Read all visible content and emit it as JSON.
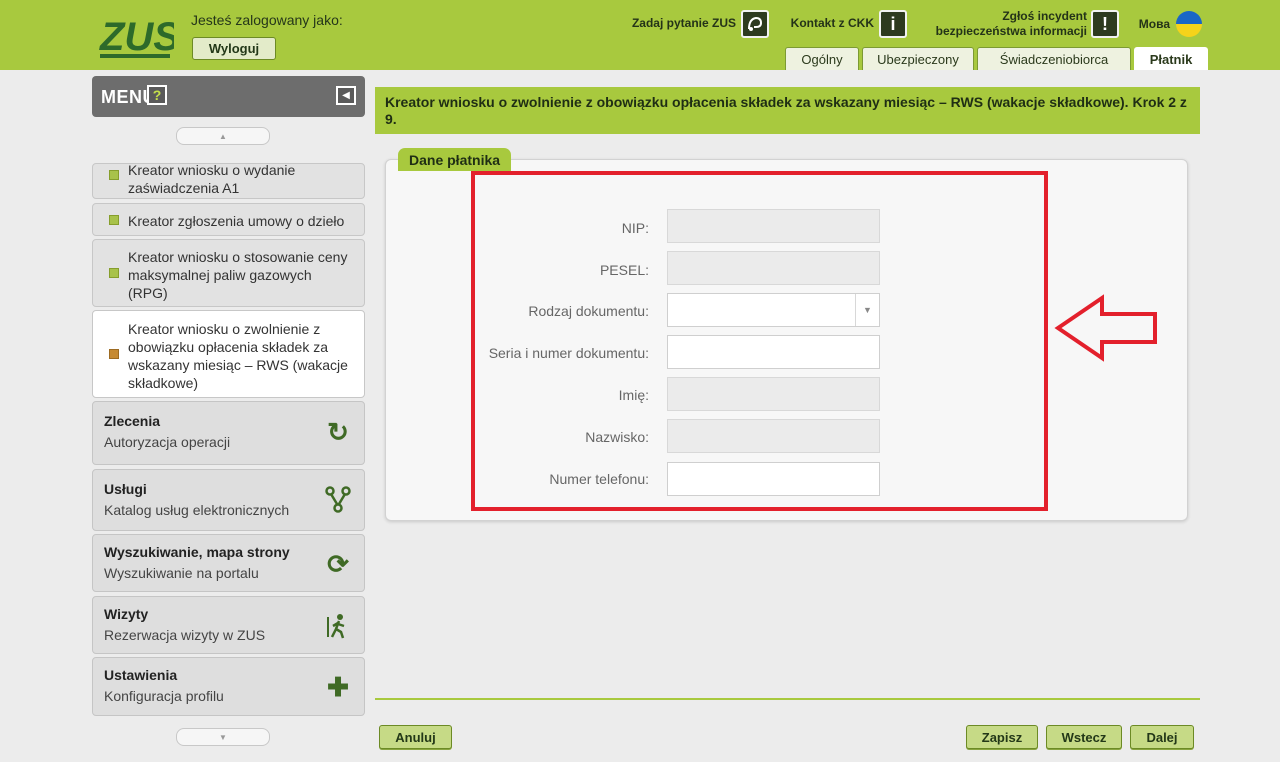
{
  "header": {
    "logo_text": "ZUS",
    "logged_label": "Jesteś zalogowany jako:",
    "logout_label": "Wyloguj",
    "ask_zus": "Zadaj pytanie ZUS",
    "contact_ckk": "Kontakt z CKK",
    "report_line1": "Zgłoś incydent",
    "report_line2": "bezpieczeństwa informacji",
    "lang_label": "Мова",
    "tabs": [
      "Ogólny",
      "Ubezpieczony",
      "Świadczeniobiorca",
      "Płatnik"
    ],
    "active_tab": "Płatnik",
    "colors": {
      "brand_green": "#a8c93e",
      "dark_green": "#3f6a25",
      "highlight_red": "#e3202c"
    }
  },
  "sidebar": {
    "menu_title": "MENU",
    "help_icon": "?",
    "items": [
      {
        "label": "Kreator wniosku o wydanie zaświadczenia A1"
      },
      {
        "label": "Kreator zgłoszenia umowy o dzieło"
      },
      {
        "label": "Kreator wniosku o stosowanie ceny maksymalnej paliw gazowych (RPG)"
      },
      {
        "label": "Kreator wniosku o zwolnienie z obowiązku opłacenia składek za wskazany miesiąc – RWS (wakacje składkowe)"
      }
    ],
    "categories": [
      {
        "title": "Zlecenia",
        "subtitle": "Autoryzacja operacji",
        "icon": "refresh-icon"
      },
      {
        "title": "Usługi",
        "subtitle": "Katalog usług elektronicznych",
        "icon": "services-icon"
      },
      {
        "title": "Wyszukiwanie, mapa strony",
        "subtitle": "Wyszukiwanie na portalu",
        "icon": "sync-icon"
      },
      {
        "title": "Wizyty",
        "subtitle": "Rezerwacja wizyty w ZUS",
        "icon": "walking-person-icon"
      },
      {
        "title": "Ustawienia",
        "subtitle": "Konfiguracja profilu",
        "icon": "puzzle-icon"
      }
    ]
  },
  "main": {
    "title": "Kreator wniosku o zwolnienie z obowiązku opłacenia składek za wskazany miesiąc – RWS (wakacje składkowe). Krok 2 z 9.",
    "section_title": "Dane płatnika",
    "fields": {
      "nip": {
        "label": "NIP:",
        "value": ""
      },
      "pesel": {
        "label": "PESEL:",
        "value": ""
      },
      "doc_type": {
        "label": "Rodzaj dokumentu:",
        "value": ""
      },
      "doc_number": {
        "label": "Seria i numer dokumentu:",
        "value": ""
      },
      "first_name": {
        "label": "Imię:",
        "value": ""
      },
      "last_name": {
        "label": "Nazwisko:",
        "value": ""
      },
      "phone": {
        "label": "Numer telefonu:",
        "value": ""
      }
    },
    "buttons": {
      "cancel": "Anuluj",
      "save": "Zapisz",
      "back": "Wstecz",
      "next": "Dalej"
    }
  }
}
